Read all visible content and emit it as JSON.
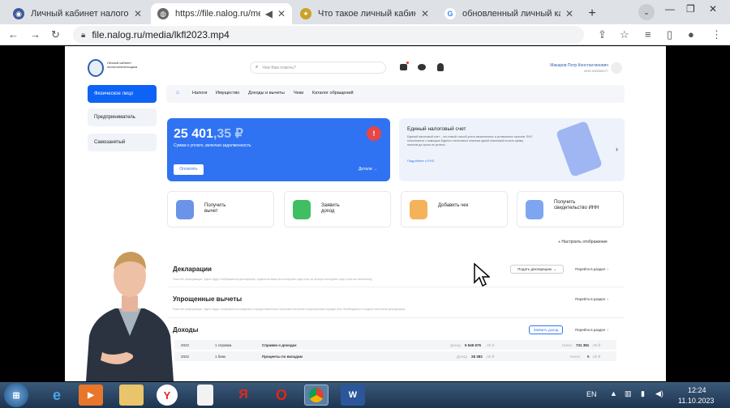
{
  "tabs": [
    {
      "label": "Личный кабинет налогопл"
    },
    {
      "label": "https://file.nalog.ru/med"
    },
    {
      "label": "Что такое личный кабинет"
    },
    {
      "label": "обновленный личный кабин"
    }
  ],
  "address": "file.nalog.ru/media/lkfl2023.mp4",
  "site": {
    "logo_text": "Личный кабинет налогоплательщика",
    "search_placeholder": "Чем Вам помочь?",
    "user_name": "Макаров Петр Константинович",
    "user_inn": "ИНН 000000077",
    "sidebar": [
      "Физическое лицо",
      "Предприниматель",
      "Самозанятый"
    ],
    "nav": [
      "Налоги",
      "Имущество",
      "Доходы и вычеты",
      "Чеки",
      "Каталог обращений"
    ],
    "balance": {
      "amount": "25 401",
      "cents": ",35 ₽",
      "caption": "Сумма к уплате, включая задолженность",
      "pay": "Оплатить",
      "details": "Детали"
    },
    "ens": {
      "title": "Единый налоговый счет",
      "text": "Единый налоговый счет – это новый способ учета начисленных и уплаченных налогов. ЕНС пополняется с помощью Единого налогового платежа одной платежкой на всю сумму налогов до срока их уплаты.",
      "link": "Подробнее о ЕНС"
    },
    "cards": [
      {
        "label": "Получить вычет"
      },
      {
        "label": "Заявить доход"
      },
      {
        "label": "Добавить чек"
      },
      {
        "label": "Получить свидетельство ИНН"
      }
    ],
    "display_settings": "Настроить отображение",
    "declarations": {
      "title": "Декларации",
      "desc": "Пока нет информации. Здесь будут отображаться декларации, поданные вами за последние годы (или за четыре последних года, если вы пенсионер)",
      "submit": "Подать декларацию",
      "go": "Перейти в раздел"
    },
    "simplified": {
      "title": "Упрощенные вычеты",
      "desc": "Пока нет информации. Здесь будут отображаться сведения о предоставленных налоговых вычетах в упрощенном порядке (без необходимости подачи налоговой декларации)",
      "go": "Перейти в раздел"
    },
    "income": {
      "title": "Доходы",
      "declare": "Заявить доход",
      "go": "Перейти в раздел",
      "rows": [
        {
          "year": "2022",
          "src": "1 справка",
          "kind": "Справки о доходах",
          "inc_label": "Доход",
          "inc": "5 545 675",
          "inc_c": ",00 ₽",
          "tax_label": "Налог",
          "tax": "731 381",
          "tax_c": ",00 ₽"
        },
        {
          "year": "2022",
          "src": "1 банк",
          "kind": "Проценты по вкладам",
          "inc_label": "Доход",
          "inc": "28 383",
          "inc_c": ",00 ₽",
          "tax_label": "Налог",
          "tax": "0",
          "tax_c": ",00 ₽"
        }
      ]
    }
  },
  "taskbar": {
    "lang": "EN",
    "time": "12:24",
    "date": "11.10.2023"
  }
}
